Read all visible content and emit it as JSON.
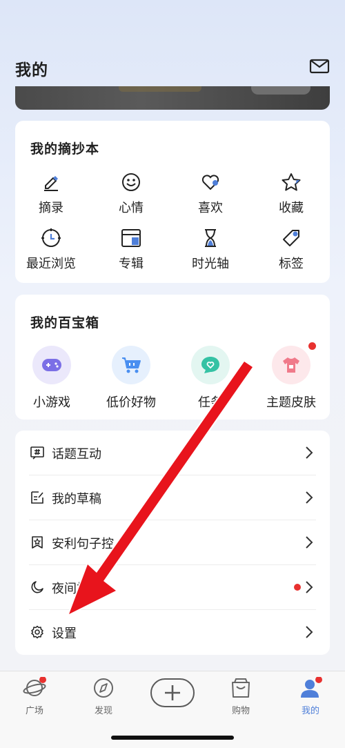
{
  "header": {
    "title": "我的"
  },
  "notebook": {
    "title": "我的摘抄本",
    "items": [
      {
        "label": "摘录",
        "icon": "pencil-icon"
      },
      {
        "label": "心情",
        "icon": "smiley-icon"
      },
      {
        "label": "喜欢",
        "icon": "heart-icon"
      },
      {
        "label": "收藏",
        "icon": "star-icon"
      },
      {
        "label": "最近浏览",
        "icon": "clock-icon"
      },
      {
        "label": "专辑",
        "icon": "album-box-icon"
      },
      {
        "label": "时光轴",
        "icon": "hourglass-icon"
      },
      {
        "label": "标签",
        "icon": "tag-icon"
      }
    ]
  },
  "toolbox": {
    "title": "我的百宝箱",
    "items": [
      {
        "label": "小游戏",
        "icon": "gamepad-icon",
        "color": "#7b6fe6"
      },
      {
        "label": "低价好物",
        "icon": "cart-icon",
        "color": "#4a8ff0"
      },
      {
        "label": "任务",
        "icon": "chat-heart-icon",
        "color": "#35c2a4"
      },
      {
        "label": "主题皮肤",
        "icon": "tshirt-icon",
        "color": "#f07a8a"
      }
    ]
  },
  "menu": {
    "items": [
      {
        "label": "话题互动",
        "icon": "hash-icon"
      },
      {
        "label": "我的草稿",
        "icon": "draft-icon"
      },
      {
        "label": "安利句子控",
        "icon": "bookmark-star-icon"
      },
      {
        "label": "夜间模式",
        "icon": "moon-icon"
      },
      {
        "label": "设置",
        "icon": "gear-icon"
      }
    ]
  },
  "tabbar": {
    "items": [
      {
        "label": "广场",
        "icon": "planet-icon"
      },
      {
        "label": "发现",
        "icon": "compass-icon"
      },
      {
        "label": "",
        "icon": "plus-icon"
      },
      {
        "label": "购物",
        "icon": "shopping-bag-icon"
      },
      {
        "label": "我的",
        "icon": "user-icon"
      }
    ]
  },
  "colors": {
    "accent": "#4f7fd9",
    "badge": "#e8312f",
    "arrow": "#e8141c"
  }
}
